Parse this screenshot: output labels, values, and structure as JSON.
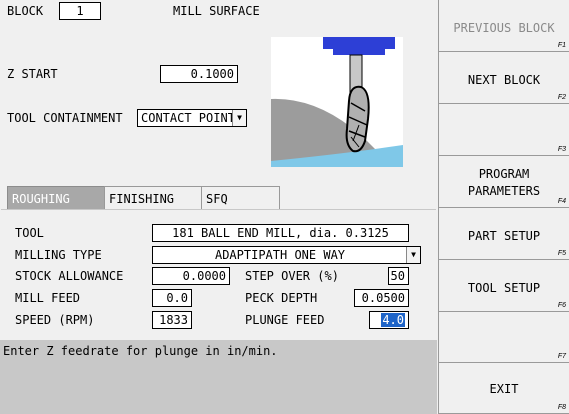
{
  "header": {
    "block_label": "BLOCK",
    "block_value": "1",
    "title": "MILL SURFACE"
  },
  "setup": {
    "z_start_label": "Z START",
    "z_start_value": "0.1000",
    "tool_containment_label": "TOOL CONTAINMENT",
    "tool_containment_value": "CONTACT POINT"
  },
  "tabs": [
    "ROUGHING",
    "FINISHING",
    "SFQ"
  ],
  "form": {
    "tool_label": "TOOL",
    "tool_value": "181 BALL END MILL, dia. 0.3125",
    "milling_type_label": "MILLING TYPE",
    "milling_type_value": "ADAPTIPATH ONE WAY",
    "stock_allowance_label": "STOCK ALLOWANCE",
    "stock_allowance_value": "0.0000",
    "step_over_label": "STEP OVER (%)",
    "step_over_value": "50",
    "mill_feed_label": "MILL FEED",
    "mill_feed_value": "0.0",
    "peck_depth_label": "PECK DEPTH",
    "peck_depth_value": "0.0500",
    "speed_label": "SPEED (RPM)",
    "speed_value": "1833",
    "plunge_feed_label": "PLUNGE FEED",
    "plunge_feed_value": "4.0"
  },
  "status": {
    "message": "Enter Z feedrate for plunge in in/min."
  },
  "fkeys": [
    {
      "label": "PREVIOUS BLOCK",
      "key": "F1",
      "enabled": false
    },
    {
      "label": "NEXT BLOCK",
      "key": "F2",
      "enabled": true
    },
    {
      "label": "",
      "key": "F3",
      "enabled": true
    },
    {
      "label": "PROGRAM PARAMETERS",
      "line1": "PROGRAM",
      "line2": "PARAMETERS",
      "key": "F4",
      "enabled": true
    },
    {
      "label": "PART SETUP",
      "key": "F5",
      "enabled": true
    },
    {
      "label": "TOOL SETUP",
      "key": "F6",
      "enabled": true
    },
    {
      "label": "",
      "key": "F7",
      "enabled": true
    },
    {
      "label": "EXIT",
      "key": "F8",
      "enabled": true
    }
  ],
  "colors": {
    "highlight": "#1e64c8",
    "tab_active": "#a8a8a8",
    "status_bar": "#c8c8c8",
    "spindle": "#2d3fd6",
    "stock": "#9c9c9c",
    "water": "#7fc8e8"
  }
}
